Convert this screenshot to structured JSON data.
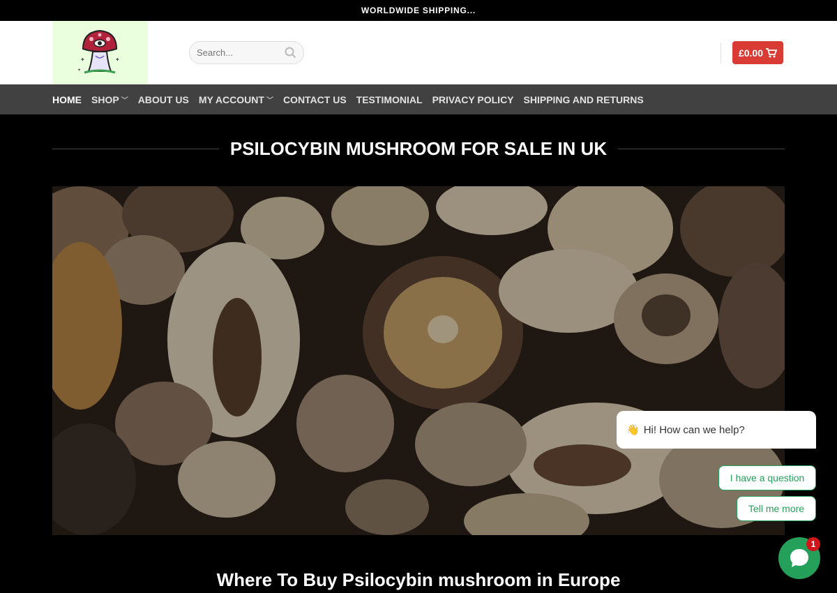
{
  "topbar": {
    "text": "WORLDWIDE SHIPPING..."
  },
  "header": {
    "search_placeholder": "Search...",
    "cart_amount": "£0.00"
  },
  "nav": {
    "items": [
      {
        "label": "HOME",
        "active": true,
        "has_dropdown": false
      },
      {
        "label": "SHOP",
        "active": false,
        "has_dropdown": true
      },
      {
        "label": "ABOUT US",
        "active": false,
        "has_dropdown": false
      },
      {
        "label": "MY ACCOUNT",
        "active": false,
        "has_dropdown": true
      },
      {
        "label": "CONTACT US",
        "active": false,
        "has_dropdown": false
      },
      {
        "label": "TESTIMONIAL",
        "active": false,
        "has_dropdown": false
      },
      {
        "label": "PRIVACY POLICY",
        "active": false,
        "has_dropdown": false
      },
      {
        "label": "SHIPPING AND RETURNS",
        "active": false,
        "has_dropdown": false
      }
    ]
  },
  "page": {
    "title": "PSILOCYBIN MUSHROOM FOR SALE IN UK",
    "subheading": "Where To Buy Psilocybin mushroom in Europe"
  },
  "chat": {
    "greeting": "Hi! How can we help?",
    "greeting_emoji": "👋",
    "option_question": "I have a question",
    "option_more": "Tell me more",
    "badge_count": "1"
  },
  "colors": {
    "accent_red": "#d93b35",
    "chat_green": "#25a05a",
    "nav_bg": "#414141"
  }
}
